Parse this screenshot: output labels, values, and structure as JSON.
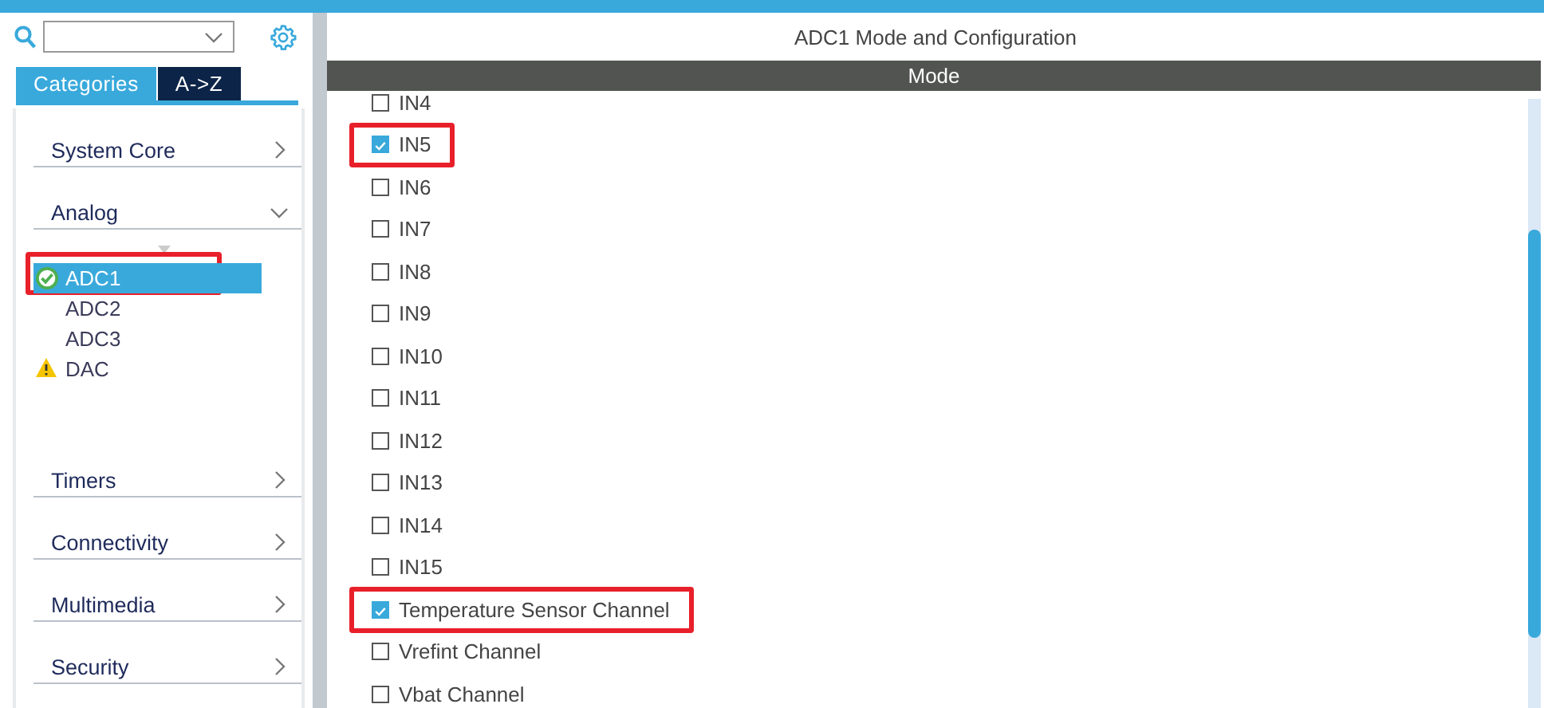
{
  "sidebar": {
    "tabs": [
      {
        "label": "Categories",
        "selected": true
      },
      {
        "label": "A->Z",
        "selected": false
      }
    ],
    "categories": [
      {
        "label": "System Core",
        "expanded": false
      },
      {
        "label": "Analog",
        "expanded": true,
        "children": [
          {
            "label": "ADC1",
            "selected": true,
            "kind": "ok",
            "highlighted": true
          },
          {
            "label": "ADC2",
            "selected": false,
            "kind": "plain",
            "highlighted": false
          },
          {
            "label": "ADC3",
            "selected": false,
            "kind": "plain",
            "highlighted": false
          },
          {
            "label": "DAC",
            "selected": false,
            "kind": "warning",
            "highlighted": false
          }
        ]
      },
      {
        "label": "Timers",
        "expanded": false
      },
      {
        "label": "Connectivity",
        "expanded": false
      },
      {
        "label": "Multimedia",
        "expanded": false
      },
      {
        "label": "Security",
        "expanded": false
      }
    ]
  },
  "panel": {
    "title": "ADC1 Mode and Configuration",
    "section": "Mode",
    "channels": [
      {
        "label": "IN4",
        "checked": false,
        "highlighted": false
      },
      {
        "label": "IN5",
        "checked": true,
        "highlighted": true
      },
      {
        "label": "IN6",
        "checked": false,
        "highlighted": false
      },
      {
        "label": "IN7",
        "checked": false,
        "highlighted": false
      },
      {
        "label": "IN8",
        "checked": false,
        "highlighted": false
      },
      {
        "label": "IN9",
        "checked": false,
        "highlighted": false
      },
      {
        "label": "IN10",
        "checked": false,
        "highlighted": false
      },
      {
        "label": "IN11",
        "checked": false,
        "highlighted": false
      },
      {
        "label": "IN12",
        "checked": false,
        "highlighted": false
      },
      {
        "label": "IN13",
        "checked": false,
        "highlighted": false
      },
      {
        "label": "IN14",
        "checked": false,
        "highlighted": false
      },
      {
        "label": "IN15",
        "checked": false,
        "highlighted": false
      },
      {
        "label": "Temperature Sensor Channel",
        "checked": true,
        "highlighted": true
      },
      {
        "label": "Vrefint Channel",
        "checked": false,
        "highlighted": false
      },
      {
        "label": "Vbat Channel",
        "checked": false,
        "highlighted": false
      }
    ]
  }
}
